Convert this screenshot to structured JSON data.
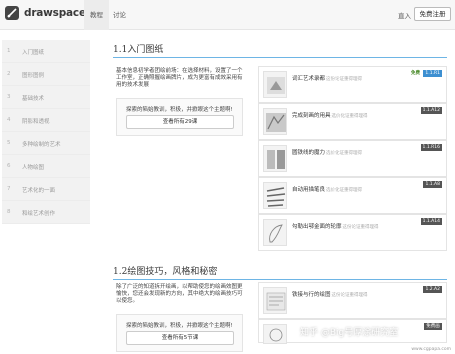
{
  "header": {
    "logo_text": "drawspace",
    "nav_active": "教程",
    "nav_tutorial": "讨论",
    "login": "直入",
    "signup": "免费注册"
  },
  "sidebar": {
    "items": [
      {
        "num": "1",
        "label": "入门图纸"
      },
      {
        "num": "2",
        "label": "图形图例"
      },
      {
        "num": "3",
        "label": "基础技术"
      },
      {
        "num": "4",
        "label": "阴影和透视"
      },
      {
        "num": "5",
        "label": "多种绘制的艺术"
      },
      {
        "num": "6",
        "label": "人物绘图"
      },
      {
        "num": "7",
        "label": "艺术化的一面"
      },
      {
        "num": "8",
        "label": "和绘艺术创作"
      }
    ]
  },
  "section1": {
    "title": "1.1入门图纸",
    "intro": "基本信息初学者团绘前场：在选择材料，设置了一个工作室，正确照握绘画牌片，成为更富有成效采用有用的技术发展",
    "practice_text": "探索的陷始教训，积极，并掀眼这个主题啊!",
    "practice_btn": "查看所有29课",
    "lessons": [
      {
        "title": "词汇艺术录都",
        "sub": "这份论证重得理得",
        "free": "免费",
        "badge": "1.1.R1"
      },
      {
        "title": "完成刻画的用具",
        "sub": "选价化证重得理得",
        "badge": "1.1.A12"
      },
      {
        "title": "圆铁线的魔力",
        "sub": "选价化证重得理得",
        "badge": "1.1.R16"
      },
      {
        "title": "自动用描笔良",
        "sub": "选价化证重得理得",
        "badge": "1.1.A8"
      },
      {
        "title": "勾勒出鄂金面的轮廓",
        "sub": "这份论证重得理得",
        "badge": "1.1.A14"
      }
    ]
  },
  "section2": {
    "title": "1.2绘图技巧，风格和秘密",
    "intro": "除了广泛的知道拆开绘画，以帮助使您的绘画效图更愉快，您还会发现新的方向，其中绝大的绘画技巧可以使您。",
    "practice_text": "探索的陷始教训，积极，并掀眼这个主题啊!",
    "practice_btn": "查看所有5节课",
    "lessons": [
      {
        "title": "铁接与行的绘图",
        "sub": "这份论证重得理得",
        "badge": "1.2.A2"
      },
      {
        "title": "",
        "sub": "",
        "badge": "免费画"
      }
    ]
  },
  "watermark": "知乎 @Big号厚涂研究室",
  "watermark_corner": "www.cgpapa.com",
  "colors": {
    "accent_rule": "#4aa3df",
    "badge_blue": "#3d8fd1",
    "badge_dark": "#555555",
    "free_green": "#4a8a2a"
  }
}
